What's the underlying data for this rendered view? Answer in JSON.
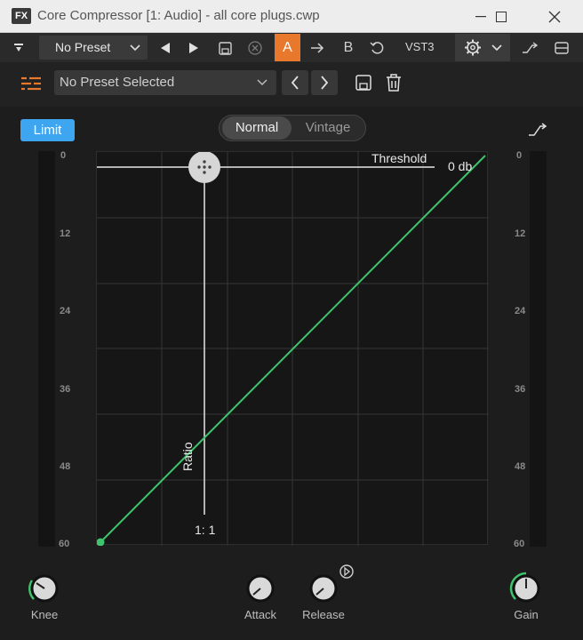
{
  "window": {
    "badge": "FX",
    "title": "Core Compressor [1: Audio] - all core plugs.cwp"
  },
  "toolbar": {
    "preset": "No Preset",
    "a_label": "A",
    "b_label": "B",
    "format": "VST3"
  },
  "preset_bar": {
    "selected": "No Preset Selected"
  },
  "controls": {
    "limit": "Limit",
    "mode_normal": "Normal",
    "mode_vintage": "Vintage"
  },
  "graph": {
    "threshold_label": "Threshold",
    "threshold_value": "0 db",
    "ratio_label": "Ratio",
    "ratio_value": "1: 1"
  },
  "scale": [
    "0",
    "12",
    "24",
    "36",
    "48",
    "60"
  ],
  "knobs": {
    "knee": "Knee",
    "attack": "Attack",
    "release": "Release",
    "gain": "Gain"
  },
  "colors": {
    "accent_orange": "#e8782c",
    "limit_blue": "#3ea6f0",
    "curve_green": "#3ec46d"
  }
}
